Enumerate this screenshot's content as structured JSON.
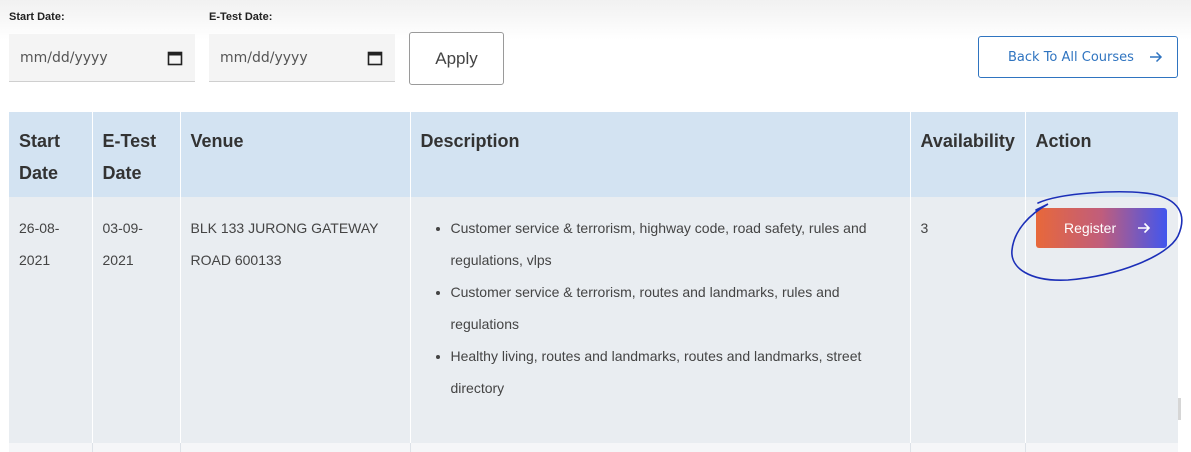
{
  "filters": {
    "start_date_label": "Start Date:",
    "start_date_placeholder": "mm/dd/yyyy",
    "etest_date_label": "E-Test Date:",
    "etest_date_placeholder": "mm/dd/yyyy",
    "apply_label": "Apply"
  },
  "back_button": {
    "label": "Back To All Courses"
  },
  "table": {
    "headers": {
      "start_line1": "Start",
      "start_line2": "Date",
      "etest_line1": "E-Test",
      "etest_line2": "Date",
      "venue": "Venue",
      "description": "Description",
      "availability": "Availability",
      "action": "Action"
    },
    "rows": [
      {
        "start_line1": "26-08-",
        "start_line2": "2021",
        "etest_line1": "03-09-",
        "etest_line2": "2021",
        "venue_line1": "BLK 133 JURONG GATEWAY",
        "venue_line2": "ROAD 600133",
        "description": [
          "Customer service & terrorism, highway code, road safety, rules and regulations, vlps",
          "Customer service & terrorism, routes and landmarks, rules and regulations",
          "Healthy living, routes and landmarks, routes and landmarks, street directory"
        ],
        "availability": "3",
        "action_label": "Register"
      }
    ]
  },
  "colors": {
    "header_bg": "#d3e3f2",
    "row_bg": "#e9edf1",
    "link_blue": "#2f74c0",
    "register_gradient_start": "#e8683a",
    "register_gradient_end": "#4156ee",
    "annotation_ink": "#1c2fb8"
  },
  "icons": {
    "date_picker": "calendar-icon",
    "arrow": "arrow-right-icon",
    "annotation": "hand-drawn-circle"
  }
}
